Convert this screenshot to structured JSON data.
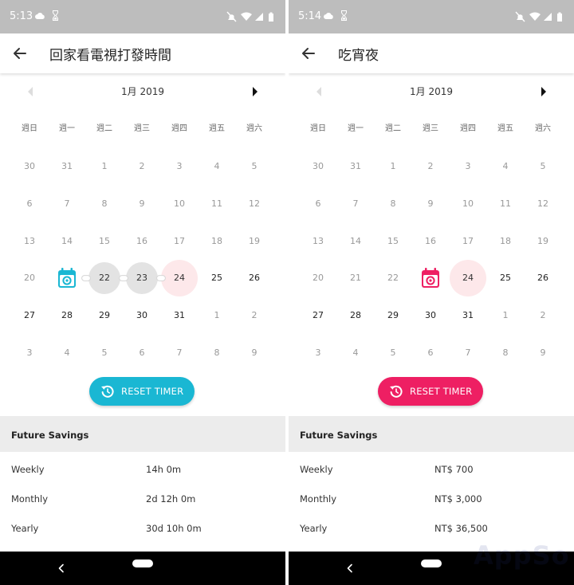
{
  "screens": [
    {
      "status_time": "5:13",
      "title": "回家看電視打發時間",
      "month_label": "1月 2019",
      "weekdays": [
        "週日",
        "週一",
        "週二",
        "週三",
        "週四",
        "週五",
        "週六"
      ],
      "weeks": [
        [
          "30",
          "31",
          "1",
          "2",
          "3",
          "4",
          "5"
        ],
        [
          "6",
          "7",
          "8",
          "9",
          "10",
          "11",
          "12"
        ],
        [
          "13",
          "14",
          "15",
          "16",
          "17",
          "18",
          "19"
        ],
        [
          "20",
          "",
          "22",
          "23",
          "24",
          "25",
          "26"
        ],
        [
          "27",
          "28",
          "29",
          "30",
          "31",
          "1",
          "2"
        ],
        [
          "3",
          "4",
          "5",
          "6",
          "7",
          "8",
          "9"
        ]
      ],
      "start_day": {
        "week": 3,
        "col": 1
      },
      "streak_days": [
        [
          3,
          2
        ],
        [
          3,
          3
        ]
      ],
      "today": {
        "week": 3,
        "col": 4
      },
      "reset_label": "RESET TIMER",
      "accent": "#1ab7d3",
      "savings_title": "Future Savings",
      "savings": [
        {
          "label": "Weekly",
          "value": "14h 0m"
        },
        {
          "label": "Monthly",
          "value": "2d 12h 0m"
        },
        {
          "label": "Yearly",
          "value": "30d 10h 0m"
        }
      ]
    },
    {
      "status_time": "5:14",
      "title": "吃宵夜",
      "month_label": "1月 2019",
      "weekdays": [
        "週日",
        "週一",
        "週二",
        "週三",
        "週四",
        "週五",
        "週六"
      ],
      "weeks": [
        [
          "30",
          "31",
          "1",
          "2",
          "3",
          "4",
          "5"
        ],
        [
          "6",
          "7",
          "8",
          "9",
          "10",
          "11",
          "12"
        ],
        [
          "13",
          "14",
          "15",
          "16",
          "17",
          "18",
          "19"
        ],
        [
          "20",
          "21",
          "22",
          "",
          "24",
          "25",
          "26"
        ],
        [
          "27",
          "28",
          "29",
          "30",
          "31",
          "1",
          "2"
        ],
        [
          "3",
          "4",
          "5",
          "6",
          "7",
          "8",
          "9"
        ]
      ],
      "start_day": {
        "week": 3,
        "col": 3
      },
      "streak_days": [],
      "today": {
        "week": 3,
        "col": 4
      },
      "reset_label": "RESET TIMER",
      "accent": "#ee1f63",
      "savings_title": "Future Savings",
      "savings": [
        {
          "label": "Weekly",
          "value": "NT$ 700"
        },
        {
          "label": "Monthly",
          "value": "NT$ 3,000"
        },
        {
          "label": "Yearly",
          "value": "NT$ 36,500"
        }
      ]
    }
  ],
  "icons": {
    "status_left": [
      "cloud-icon",
      "hourglass-icon"
    ],
    "status_right": [
      "alarm-off-icon",
      "wifi-icon",
      "signal-icon",
      "battery-icon"
    ],
    "app_bar": "arrow-left-icon",
    "calendar_prev": "caret-left-icon",
    "calendar_next": "caret-right-icon",
    "start_marker": "calendar-start-icon",
    "reset": "reset-arrow-icon",
    "nav": [
      "nav-back-icon",
      "nav-home-pill"
    ]
  },
  "watermark": "AppSo"
}
